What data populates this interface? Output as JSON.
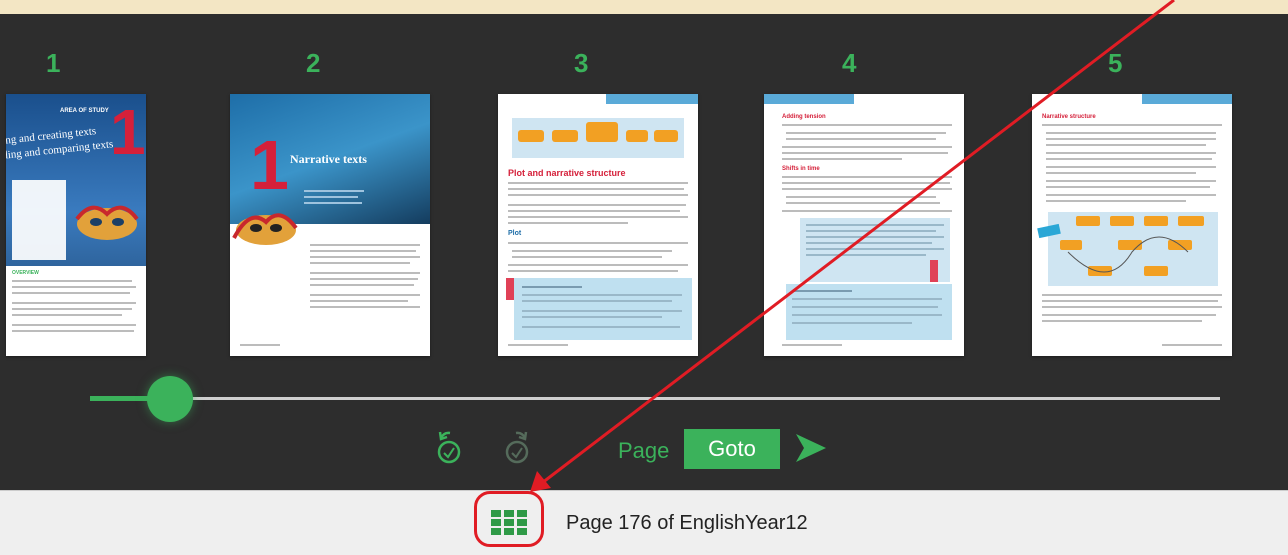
{
  "thumbnails": [
    {
      "number": "1"
    },
    {
      "number": "2"
    },
    {
      "number": "3"
    },
    {
      "number": "4"
    },
    {
      "number": "5"
    }
  ],
  "page1": {
    "area": "AREA OF STUDY",
    "big_num": "1",
    "title1": "ing and creating texts",
    "title2": "ding and comparing texts",
    "overview": "OVERVIEW"
  },
  "page2": {
    "big_num": "1",
    "title": "Narrative texts"
  },
  "page3": {
    "heading": "Plot and narrative structure",
    "sub": "Plot"
  },
  "page4": {
    "heading": "Adding tension",
    "sub": "Shifts in time"
  },
  "page5": {
    "heading": "Narrative structure"
  },
  "slider": {
    "progress_percent": 6
  },
  "controls": {
    "back_icon": "rotate-back-icon",
    "forward_icon": "rotate-forward-icon",
    "page_label": "Page",
    "goto_label": "Goto",
    "next_icon": "play-arrow-icon"
  },
  "status_bar": {
    "grid_icon": "grid-view-icon",
    "status_text": "Page 176 of EnglishYear12"
  },
  "colors": {
    "accent": "#3bb25b",
    "annotation": "#e01c24",
    "background": "#2d2d2d"
  }
}
